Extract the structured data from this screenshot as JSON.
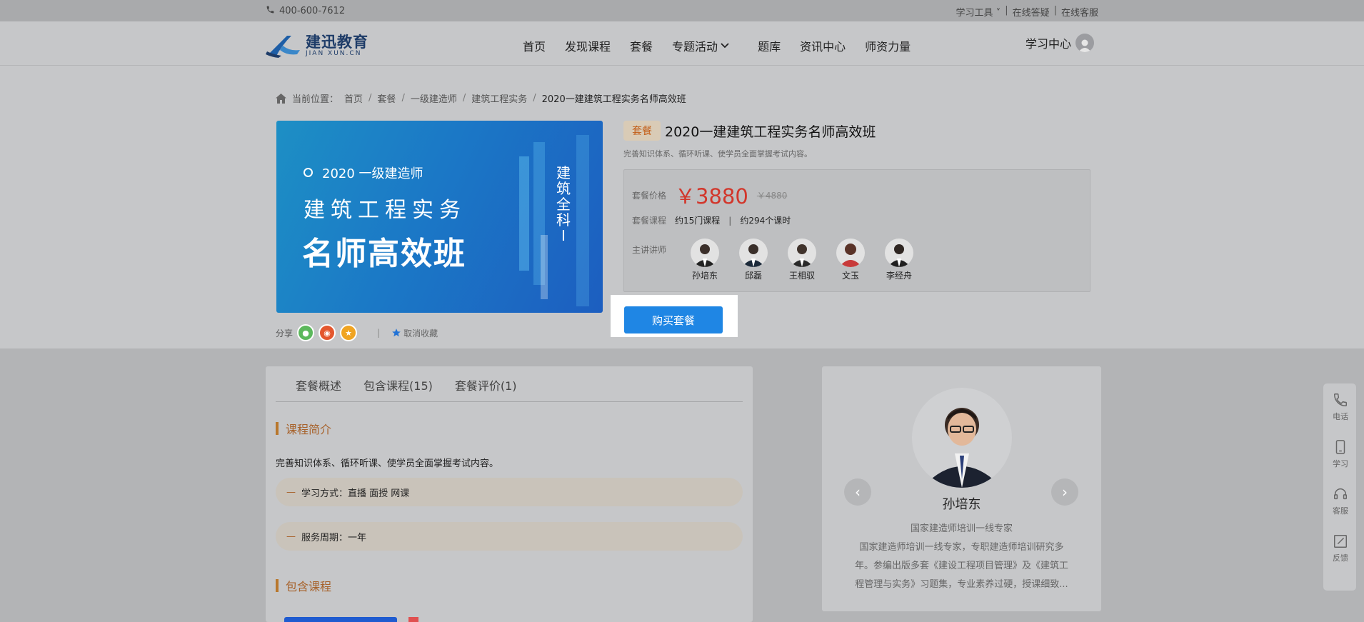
{
  "topbar": {
    "phone": "400-600-7612",
    "links": [
      "学习工具",
      "在线答疑",
      "在线客服"
    ]
  },
  "logo": {
    "cn": "建迅教育",
    "en": "JIAN XUN.CN"
  },
  "nav": {
    "items": [
      "首页",
      "发现课程",
      "套餐",
      "专题活动",
      "题库",
      "资讯中心",
      "师资力量"
    ],
    "user_center": "学习中心"
  },
  "breadcrumb": {
    "label": "当前位置：",
    "items": [
      "首页",
      "套餐",
      "一级建造师",
      "建筑工程实务"
    ],
    "current": "2020一建建筑工程实务名师高效班"
  },
  "banner": {
    "line1": "2020 一级建造师",
    "line2": "建筑工程实务",
    "line3": "名师高效班",
    "vertical": "建筑全科Ⅰ"
  },
  "share": {
    "label": "分享",
    "favorite": "取消收藏"
  },
  "product": {
    "tag": "套餐",
    "title": "2020一建建筑工程实务名师高效班",
    "desc": "完善知识体系、循环听课、使学员全面掌握考试内容。",
    "price_label": "套餐价格",
    "price": "￥3880",
    "old_price": "￥4880",
    "course_label": "套餐课程",
    "course_count": "约15门课程",
    "hours": "约294个课时",
    "teacher_label": "主讲讲师",
    "teachers": [
      "孙培东",
      "邱磊",
      "王相驭",
      "文玉",
      "李经舟"
    ],
    "buy": "购买套餐"
  },
  "tabs": [
    "套餐概述",
    "包含课程(15)",
    "套餐评价(1)"
  ],
  "intro": {
    "heading": "课程简介",
    "text": "完善知识体系、循环听课、使学员全面掌握考试内容。",
    "study_mode": "学习方式：直播 面授 网课",
    "service": "服务周期：一年",
    "courses_heading": "包含课程"
  },
  "teacher_card": {
    "name": "孙培东",
    "title": "国家建造师培训一线专家",
    "desc": "国家建造师培训一线专家，专职建造师培训研究多年。参编出版多套《建设工程项目管理》及《建筑工程管理与实务》习题集，专业素养过硬，授课细致..."
  },
  "sidebar": [
    "电话",
    "学习",
    "客服",
    "反馈"
  ],
  "colors": {
    "accent": "#1f86e4",
    "price": "#d2362b",
    "brand": "#a7622b"
  }
}
